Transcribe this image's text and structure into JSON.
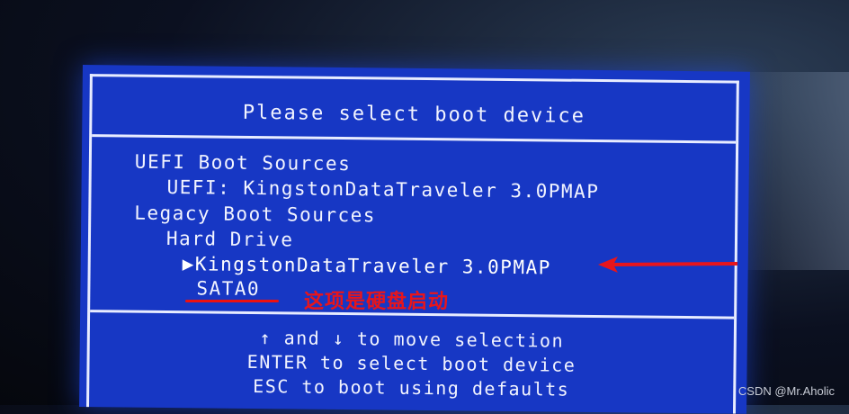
{
  "boot_menu": {
    "title": "Please select boot device",
    "items": [
      "UEFI Boot Sources",
      "UEFI: KingstonDataTraveler 3.0PMAP",
      "Legacy Boot Sources",
      "Hard Drive",
      "▶KingstonDataTraveler 3.0PMAP",
      "SATA0"
    ],
    "footer": [
      "↑ and ↓ to move selection",
      "ENTER to select boot device",
      "ESC to boot using defaults"
    ]
  },
  "annotation": {
    "text": "这项是硬盘启动",
    "color": "#e8151b"
  },
  "watermark": "CSDN @Mr.Aholic",
  "colors": {
    "bios_background": "#1737c4",
    "bios_text": "#f2f4ff"
  }
}
